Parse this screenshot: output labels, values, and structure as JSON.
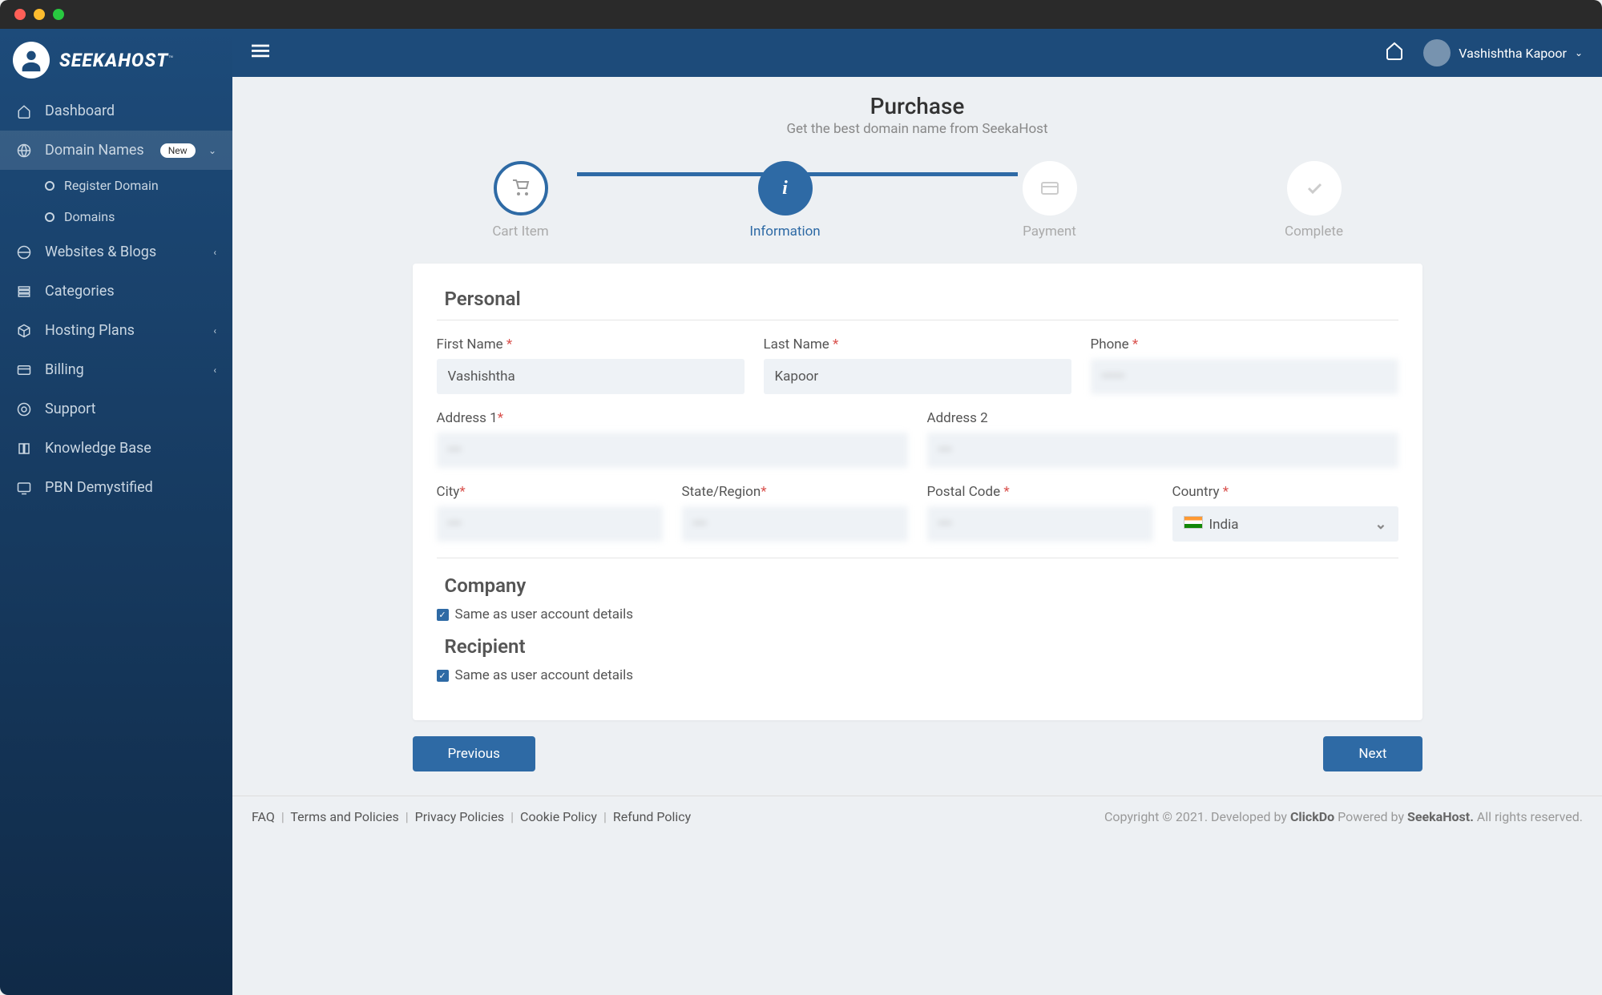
{
  "brand": {
    "name": "SEEKAHOST",
    "tm": "™"
  },
  "user": {
    "name": "Vashishtha Kapoor"
  },
  "sidebar": {
    "items": [
      {
        "label": "Dashboard"
      },
      {
        "label": "Domain Names",
        "badge": "New"
      },
      {
        "label": "Websites & Blogs"
      },
      {
        "label": "Categories"
      },
      {
        "label": "Hosting Plans"
      },
      {
        "label": "Billing"
      },
      {
        "label": "Support"
      },
      {
        "label": "Knowledge Base"
      },
      {
        "label": "PBN Demystified"
      }
    ],
    "subitems": [
      {
        "label": "Register Domain"
      },
      {
        "label": "Domains"
      }
    ]
  },
  "page": {
    "title": "Purchase",
    "subtitle": "Get the best domain name from SeekaHost"
  },
  "steps": [
    {
      "label": "Cart Item"
    },
    {
      "label": "Information"
    },
    {
      "label": "Payment"
    },
    {
      "label": "Complete"
    }
  ],
  "form": {
    "personal_title": "Personal",
    "company_title": "Company",
    "recipient_title": "Recipient",
    "first_name_label": "First Name",
    "first_name_value": "Vashishtha",
    "last_name_label": "Last Name",
    "last_name_value": "Kapoor",
    "phone_label": "Phone",
    "phone_value": "",
    "address1_label": "Address 1",
    "address2_label": "Address 2",
    "city_label": "City",
    "state_label": "State/Region",
    "postal_label": "Postal Code",
    "country_label": "Country",
    "country_value": "India",
    "same_as_label": "Same as user account details"
  },
  "buttons": {
    "previous": "Previous",
    "next": "Next"
  },
  "footer": {
    "links": {
      "faq": "FAQ",
      "terms": "Terms and Policies",
      "privacy": "Privacy Policies",
      "cookie": "Cookie Policy",
      "refund": "Refund Policy"
    },
    "copyright_prefix": "Copyright © 2021. Developed by ",
    "clickdo": "ClickDo",
    "powered": " Powered by ",
    "seekahost": "SeekaHost.",
    "rights": " All rights reserved."
  }
}
